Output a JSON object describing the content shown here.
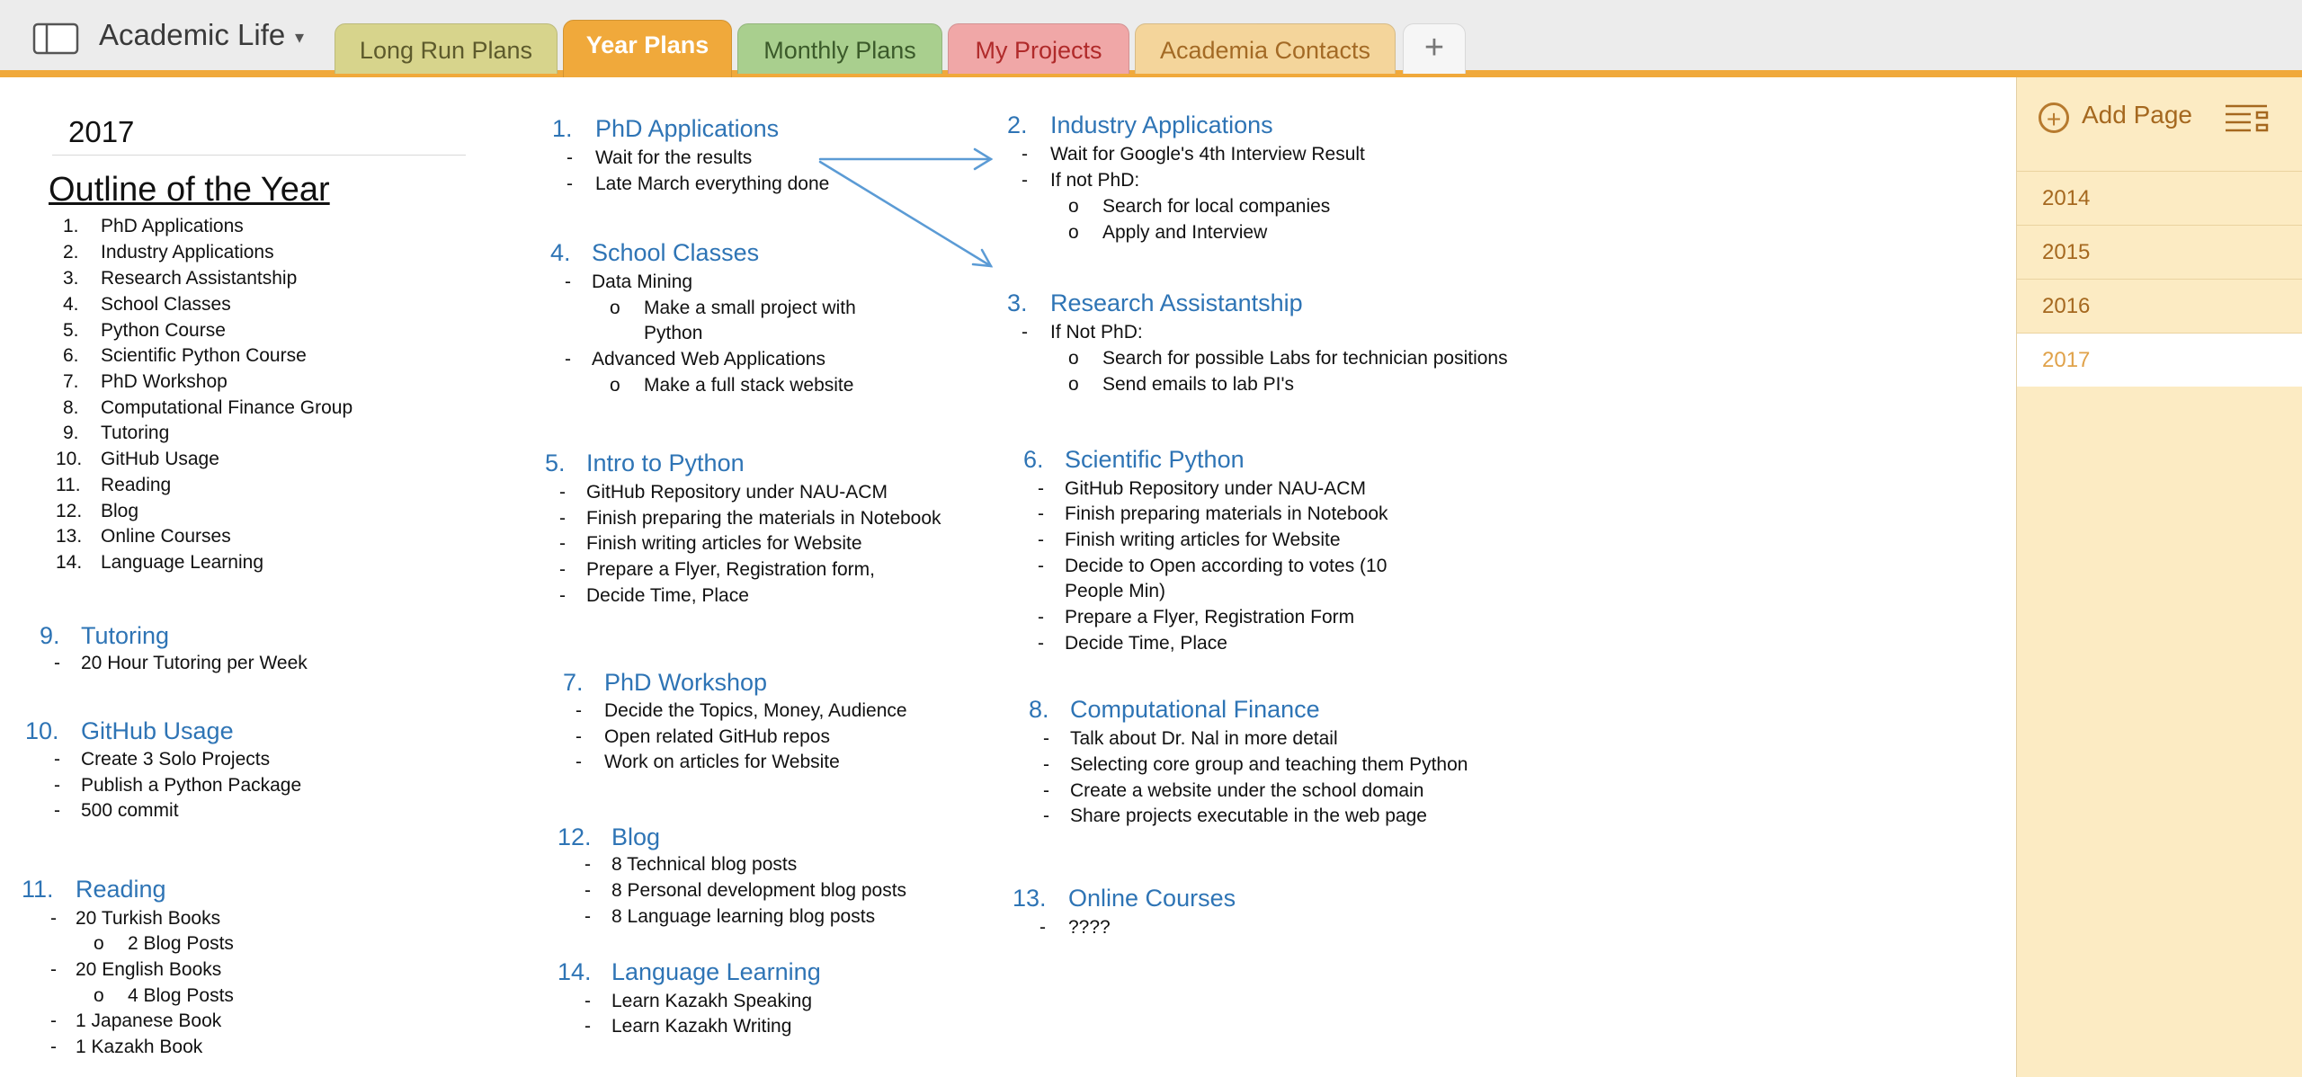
{
  "app": {
    "notebook_title": "Academic Life",
    "notebook_caret": "▾",
    "accent_color": "#f0a93b"
  },
  "tabs": {
    "long_run": "Long Run Plans",
    "year_plans": "Year Plans",
    "monthly": "Monthly Plans",
    "my_projects": "My Projects",
    "contacts": "Academia Contacts",
    "add": "+"
  },
  "sidebar": {
    "add_page": "Add Page",
    "add_icon": "+",
    "pages": [
      "2014",
      "2015",
      "2016",
      "2017"
    ],
    "selected_page": "2017"
  },
  "page": {
    "year": "2017",
    "outline_title": "Outline of the Year",
    "outline": [
      {
        "n": "1.",
        "text": "PhD Applications"
      },
      {
        "n": "2.",
        "text": "Industry Applications"
      },
      {
        "n": "3.",
        "text": "Research Assistantship"
      },
      {
        "n": "4.",
        "text": "School Classes"
      },
      {
        "n": "5.",
        "text": "Python Course"
      },
      {
        "n": "6.",
        "text": "Scientific Python Course"
      },
      {
        "n": "7.",
        "text": "PhD Workshop"
      },
      {
        "n": "8.",
        "text": "Computational Finance Group"
      },
      {
        "n": "9.",
        "text": "Tutoring"
      },
      {
        "n": "10.",
        "text": "GitHub Usage"
      },
      {
        "n": "11.",
        "text": "Reading"
      },
      {
        "n": "12.",
        "text": "Blog"
      },
      {
        "n": "13.",
        "text": "Online Courses"
      },
      {
        "n": "14.",
        "text": "Language Learning"
      }
    ],
    "sections": {
      "tutoring": {
        "n": "9.",
        "title": "Tutoring",
        "items": [
          "20 Hour Tutoring per Week"
        ]
      },
      "github": {
        "n": "10.",
        "title": "GitHub Usage",
        "items": [
          "Create 3 Solo Projects",
          "Publish a Python Package",
          "500 commit"
        ]
      },
      "reading": {
        "n": "11.",
        "title": "Reading",
        "items": [
          "20 Turkish Books",
          "2 Blog Posts",
          "20 English Books",
          "4 Blog Posts",
          "1 Japanese Book",
          "1 Kazakh Book"
        ]
      },
      "phd_apps": {
        "n": "1.",
        "title": "PhD Applications",
        "items": [
          "Wait for the results",
          "Late March everything done"
        ]
      },
      "classes": {
        "n": "4.",
        "title": "School Classes",
        "items": [
          "Data Mining",
          "Make a small project with",
          "Python",
          "Advanced Web Applications",
          "Make a full stack website"
        ]
      },
      "intro_python": {
        "n": "5.",
        "title": "Intro to Python",
        "items": [
          "GitHub Repository under NAU-ACM",
          "Finish preparing the materials in Notebook",
          "Finish writing articles for Website",
          "Prepare a Flyer, Registration form,",
          "Decide Time, Place"
        ]
      },
      "workshop": {
        "n": "7.",
        "title": "PhD Workshop",
        "items": [
          "Decide the Topics, Money, Audience",
          "Open related GitHub repos",
          "Work on articles for Website"
        ]
      },
      "blog": {
        "n": "12.",
        "title": "Blog",
        "items": [
          "8 Technical blog posts",
          "8 Personal development blog posts",
          "8 Language learning blog posts"
        ]
      },
      "language": {
        "n": "14.",
        "title": "Language Learning",
        "items": [
          "Learn Kazakh Speaking",
          "Learn Kazakh Writing"
        ]
      },
      "industry": {
        "n": "2.",
        "title": "Industry Applications",
        "items": [
          "Wait for Google's 4th Interview Result",
          "If not PhD:",
          "Search for local companies",
          "Apply and Interview"
        ]
      },
      "research": {
        "n": "3.",
        "title": "Research Assistantship",
        "items": [
          "If Not PhD:",
          "Search for possible Labs for technician positions",
          "Send emails to lab PI's"
        ]
      },
      "sci_python": {
        "n": "6.",
        "title": "Scientific Python",
        "items": [
          "GitHub Repository under NAU-ACM",
          "Finish preparing materials in Notebook",
          "Finish writing articles for Website",
          "Decide to Open according to votes (10",
          "People Min)",
          "Prepare a Flyer, Registration Form",
          "Decide Time, Place"
        ]
      },
      "comp_finance": {
        "n": "8.",
        "title": "Computational Finance",
        "items": [
          "Talk about Dr. Nal in more detail",
          "Selecting core group and teaching them Python",
          "Create a website under the school domain",
          "Share projects executable in the web page"
        ]
      },
      "online": {
        "n": "13.",
        "title": "Online Courses",
        "items": [
          "????"
        ]
      }
    },
    "bullets": {
      "dash": "-",
      "circle": "o"
    }
  }
}
